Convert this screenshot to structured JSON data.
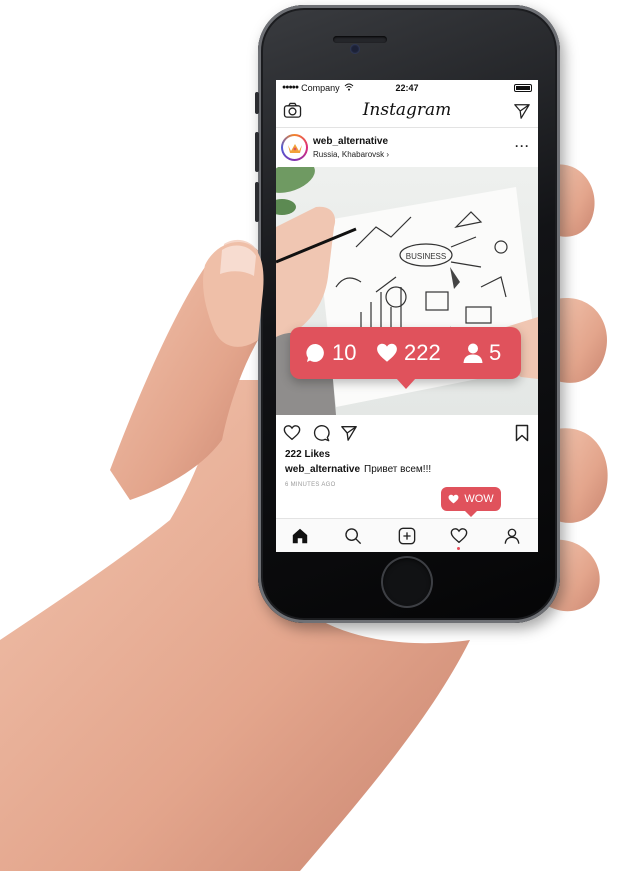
{
  "status_bar": {
    "carrier": "Company",
    "time": "22:47"
  },
  "nav": {
    "brand": "Instagram"
  },
  "post": {
    "username": "web_alternative",
    "location": "Russia, Khabarovsk",
    "image_text": "BUSINESS",
    "likes_text": "222 Likes",
    "caption_user": "web_alternative",
    "caption_text": "Привет всем!!!",
    "timestamp": "6 MINUTES AGO"
  },
  "notification": {
    "comments": "10",
    "likes": "222",
    "followers": "5"
  },
  "reaction_badge": {
    "label": "WOW"
  },
  "icons": {
    "camera": "camera-icon",
    "send": "send-icon",
    "more": "more-icon",
    "heart": "heart-icon",
    "comment": "comment-icon",
    "share": "share-icon",
    "bookmark": "bookmark-icon",
    "home": "home-icon",
    "search": "search-icon",
    "add": "add-post-icon",
    "activity": "activity-heart-icon",
    "profile": "profile-icon",
    "user": "user-icon"
  },
  "colors": {
    "badge_red": "#e0525c",
    "text": "#111111",
    "muted": "#9a9a9a"
  }
}
